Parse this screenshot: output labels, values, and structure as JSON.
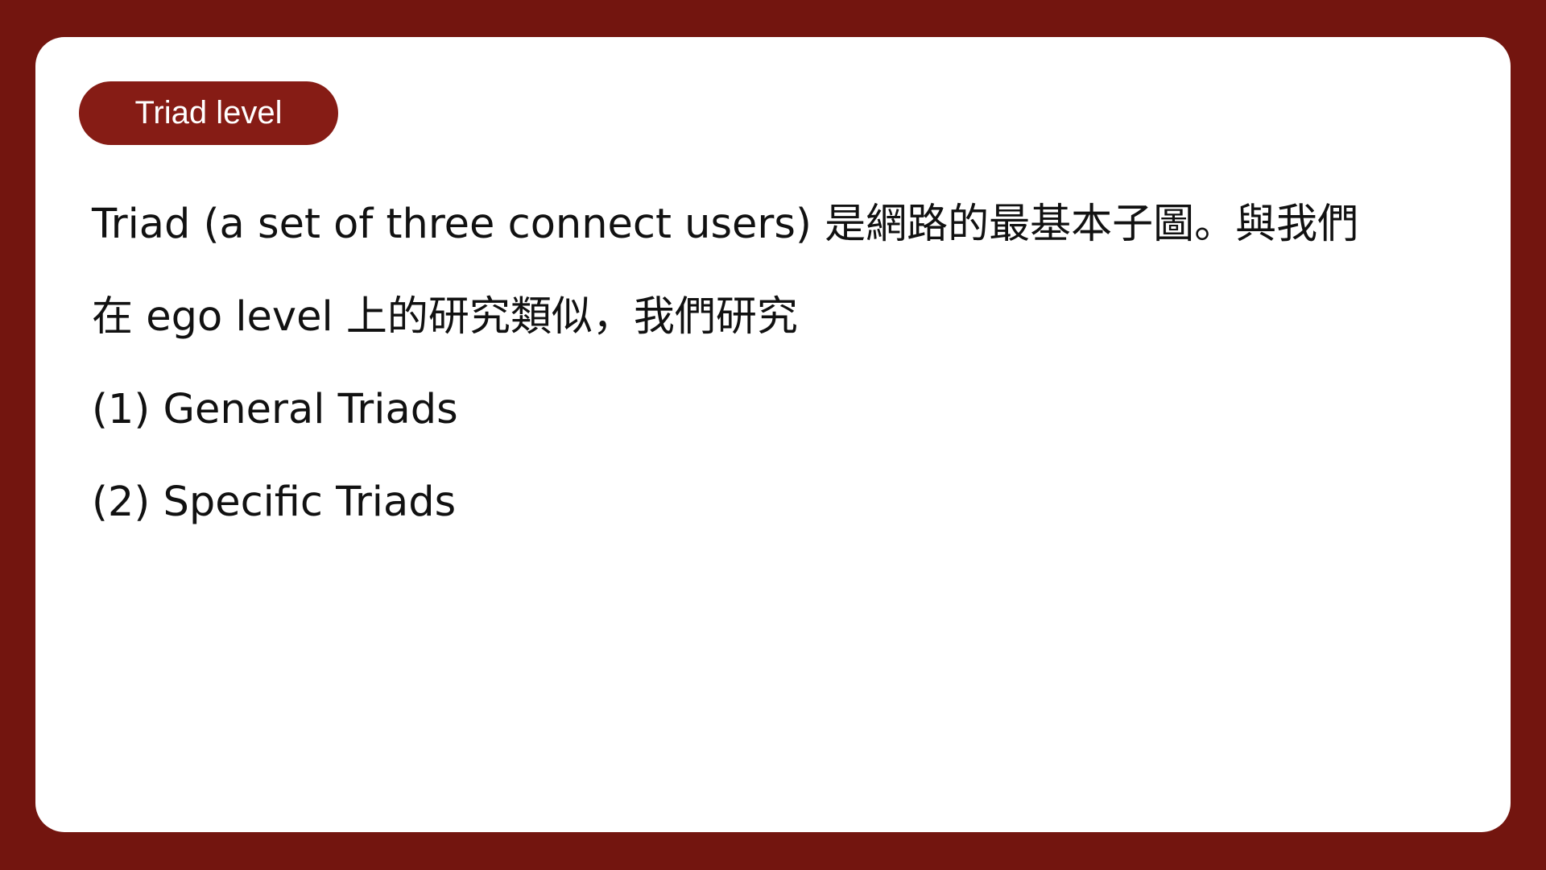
{
  "slide": {
    "section_label": "Triad level",
    "paragraph_lines": [
      "Triad (a set of three connect users) 是網路的最基本子圖。與我們",
      "在 ego level 上的研究類似，我們研究"
    ],
    "list_items": [
      "(1) General Triads",
      "(2) Specific Triads"
    ]
  },
  "colors": {
    "frame_background": "#73150f",
    "card_background": "#ffffff",
    "pill_background": "#861c15",
    "text": "#111111"
  }
}
